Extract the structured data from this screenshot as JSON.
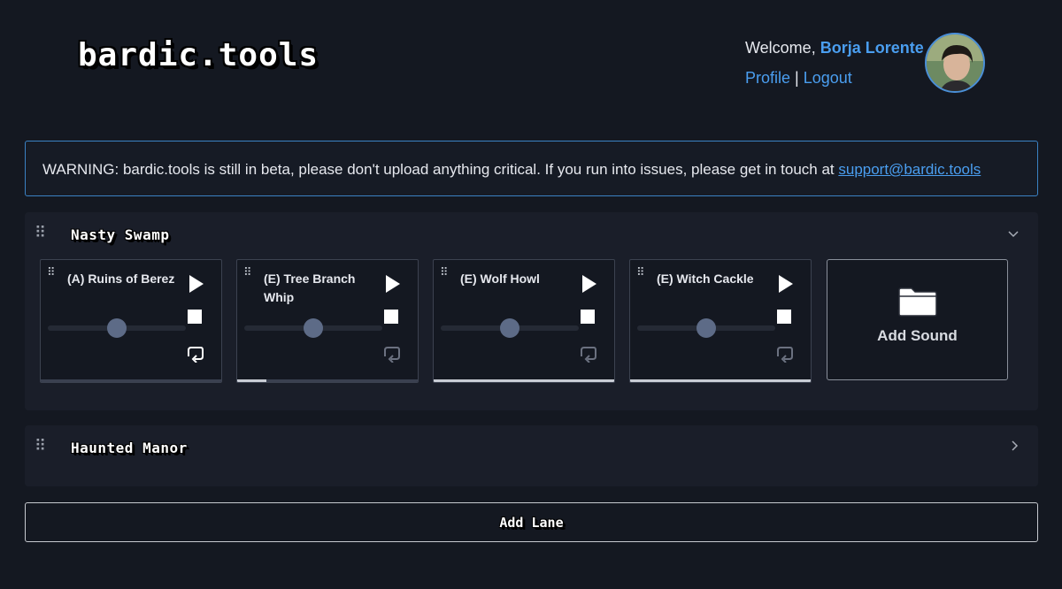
{
  "header": {
    "logo": "bardic.tools",
    "welcome_prefix": "Welcome, ",
    "user_name": "Borja Lorente",
    "profile_link": "Profile",
    "separator": " | ",
    "logout_link": "Logout"
  },
  "warning": {
    "text": "WARNING: bardic.tools is still in beta, please don't upload anything critical. If you run into issues, please get in touch at ",
    "email": "support@bardic.tools"
  },
  "lanes": [
    {
      "title": "Nasty Swamp",
      "expanded": true,
      "sounds": [
        {
          "title": "(A) Ruins of Berez",
          "volume_percent": 50,
          "loop_active": true,
          "progress_percent": 0
        },
        {
          "title": "(E) Tree Branch Whip",
          "volume_percent": 50,
          "loop_active": false,
          "progress_percent": 16
        },
        {
          "title": "(E) Wolf Howl",
          "volume_percent": 50,
          "loop_active": false,
          "progress_percent": 100
        },
        {
          "title": "(E) Witch Cackle",
          "volume_percent": 50,
          "loop_active": false,
          "progress_percent": 100
        }
      ],
      "add_sound_label": "Add Sound"
    },
    {
      "title": "Haunted Manor",
      "expanded": false
    }
  ],
  "add_lane_label": "Add Lane",
  "colors": {
    "background": "#141821",
    "lane_background": "#1a1e29",
    "accent_link": "#4a9ef0",
    "warning_border": "#3a82c4",
    "slider_thumb": "#5d6b87"
  },
  "icons": {
    "drag_handle": "drag-handle-icon",
    "play": "play-icon",
    "stop": "stop-icon",
    "loop": "loop-icon",
    "folder": "folder-icon",
    "chevron_down": "chevron-down-icon",
    "chevron_right": "chevron-right-icon"
  }
}
